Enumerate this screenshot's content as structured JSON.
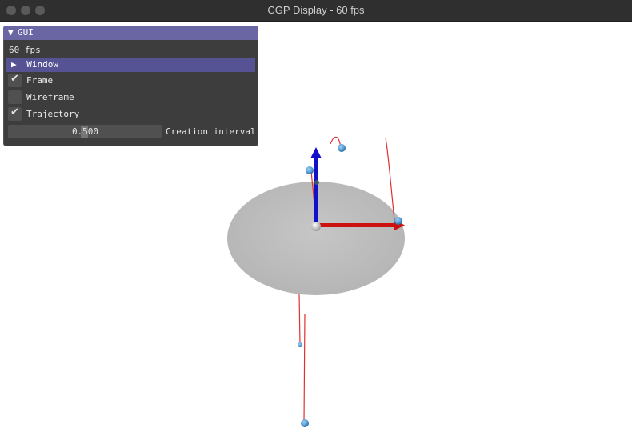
{
  "window": {
    "title": "CGP Display - 60 fps"
  },
  "gui": {
    "header": "GUI",
    "fps_text": "60 fps",
    "window_section": "Window",
    "checkboxes": [
      {
        "label": "Frame",
        "checked": true
      },
      {
        "label": "Wireframe",
        "checked": false
      },
      {
        "label": "Trajectory",
        "checked": true
      }
    ],
    "slider": {
      "value": "0.500",
      "label": "Creation interval"
    }
  },
  "icons": {
    "header_toggle": "triangle-down-icon",
    "section_toggle": "triangle-right-icon",
    "check": "check-icon"
  },
  "colors": {
    "gui_header": "#6a66a4",
    "section_highlight": "#555394",
    "axis_x": "#cc1111",
    "axis_z": "#1111cc",
    "trajectory": "#e03030",
    "particle": "#5aa0d8",
    "disc": "#bdbdbd"
  }
}
